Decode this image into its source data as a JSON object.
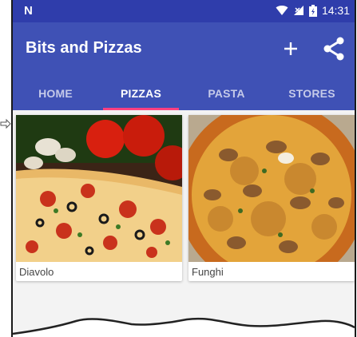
{
  "status_bar": {
    "carrier_icon": "N",
    "time": "14:31",
    "icons": [
      "wifi-icon",
      "signal-icon",
      "battery-icon"
    ]
  },
  "app_bar": {
    "title": "Bits and Pizzas",
    "actions": [
      "add-icon",
      "share-icon"
    ]
  },
  "tabs": [
    {
      "label": "HOME",
      "active": false
    },
    {
      "label": "PIZZAS",
      "active": true
    },
    {
      "label": "PASTA",
      "active": false
    },
    {
      "label": "STORES",
      "active": false
    }
  ],
  "pizzas": [
    {
      "name": "Diavolo"
    },
    {
      "name": "Funghi"
    }
  ],
  "colors": {
    "primary": "#3f51b5",
    "primary_dark": "#2f3dab",
    "accent": "#ff4081"
  }
}
